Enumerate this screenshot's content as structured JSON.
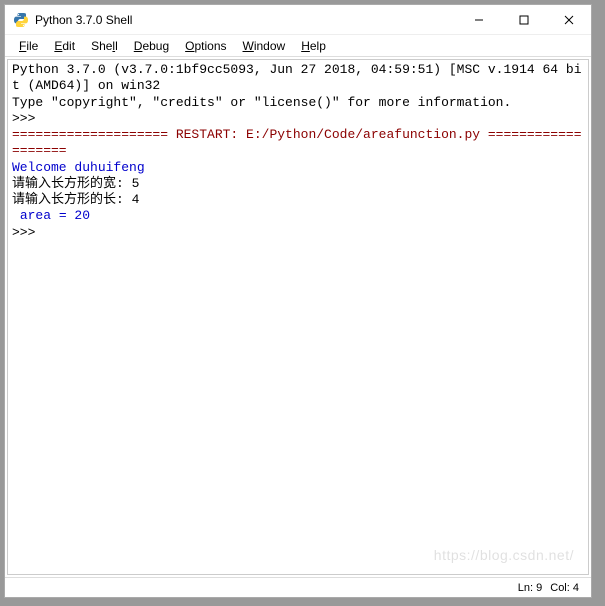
{
  "window": {
    "title": "Python 3.7.0 Shell"
  },
  "menu": {
    "file": "File",
    "edit": "Edit",
    "shell": "Shell",
    "debug": "Debug",
    "options": "Options",
    "window": "Window",
    "help": "Help"
  },
  "shell": {
    "banner1": "Python 3.7.0 (v3.7.0:1bf9cc5093, Jun 27 2018, 04:59:51) [MSC v.1914 64 bit (AMD64)] on win32",
    "banner2": "Type \"copyright\", \"credits\" or \"license()\" for more information.",
    "prompt1": ">>> ",
    "restart": "==================== RESTART: E:/Python/Code/areafunction.py ===================",
    "welcome": "Welcome duhuifeng",
    "input1": "请输入长方形的宽: 5",
    "input2": "请输入长方形的长: 4",
    "result": " area = 20",
    "prompt2": ">>> "
  },
  "status": {
    "ln": "Ln: 9",
    "col": "Col: 4"
  },
  "watermark": "https://blog.csdn.net/"
}
